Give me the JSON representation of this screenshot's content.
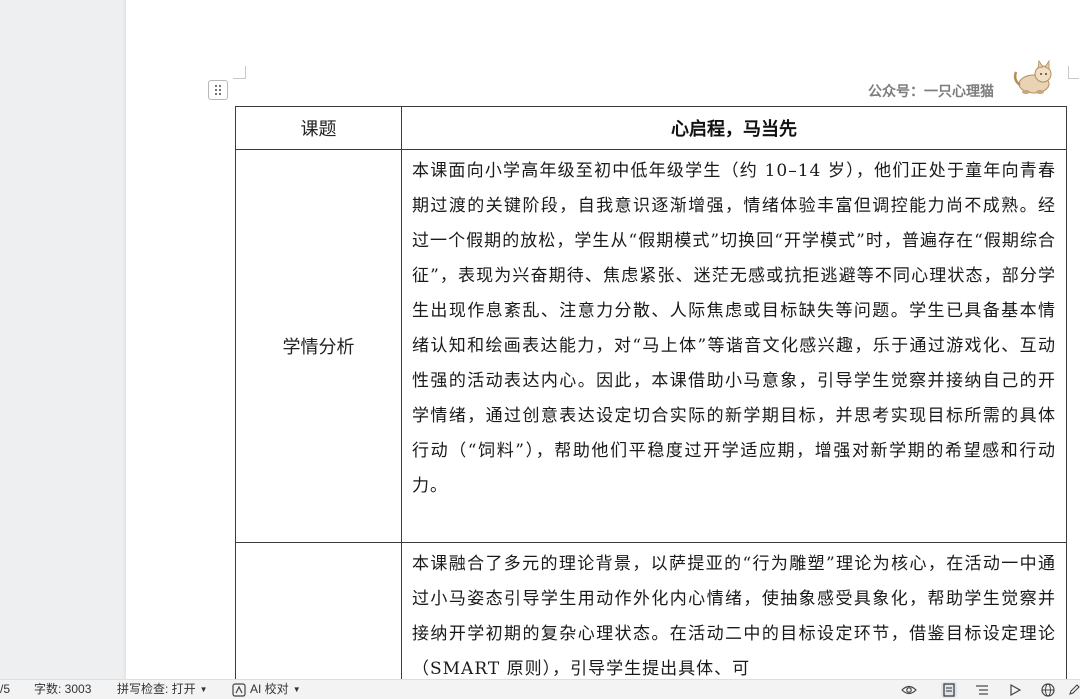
{
  "document": {
    "header_text": "公众号：一只心理猫",
    "table": {
      "row_title": {
        "label": "课题",
        "value": "心启程，马当先"
      },
      "row_analysis": {
        "label": "学情分析",
        "text": "本课面向小学高年级至初中低年级学生（约 10–14 岁），他们正处于童年向青春期过渡的关键阶段，自我意识逐渐增强，情绪体验丰富但调控能力尚不成熟。经过一个假期的放松，学生从“假期模式”切换回“开学模式”时，普遍存在“假期综合征”，表现为兴奋期待、焦虑紧张、迷茫无感或抗拒逃避等不同心理状态，部分学生出现作息紊乱、注意力分散、人际焦虑或目标缺失等问题。学生已具备基本情绪认知和绘画表达能力，对“马上体”等谐音文化感兴趣，乐于通过游戏化、互动性强的活动表达内心。因此，本课借助小马意象，引导学生觉察并接纳自己的开学情绪，通过创意表达设定切合实际的新学期目标，并思考实现目标所需的具体行动（“饲料”），帮助他们平稳度过开学适应期，增强对新学期的希望感和行动力。"
      },
      "row_theory": {
        "label": "",
        "text": "本课融合了多元的理论背景，以萨提亚的“行为雕塑”理论为核心，在活动一中通过小马姿态引导学生用动作外化内心情绪，使抽象感受具象化，帮助学生觉察并接纳开学初期的复杂心理状态。在活动二中的目标设定环节，借鉴目标设定理论（SMART 原则），引导学生提出具体、可"
      }
    }
  },
  "status_bar": {
    "page": "/5",
    "word_count": "字数: 3003",
    "spell_check": "拼写检查: 打开",
    "ai_proofread": "AI 校对"
  },
  "icons": {
    "table_handle": "move-handle-icon",
    "logo": "cat-logo-icon",
    "ai": "ai-proofread-icon",
    "read_mode": "eye-icon",
    "page_view": "page-view-icon",
    "outline": "outline-icon",
    "play": "play-icon",
    "web": "globe-icon",
    "edit": "pen-icon"
  },
  "colors": {
    "canvas": "#eeeff1",
    "page": "#ffffff",
    "table_border": "#3c3c3c",
    "header_text": "#7d7d7d"
  }
}
